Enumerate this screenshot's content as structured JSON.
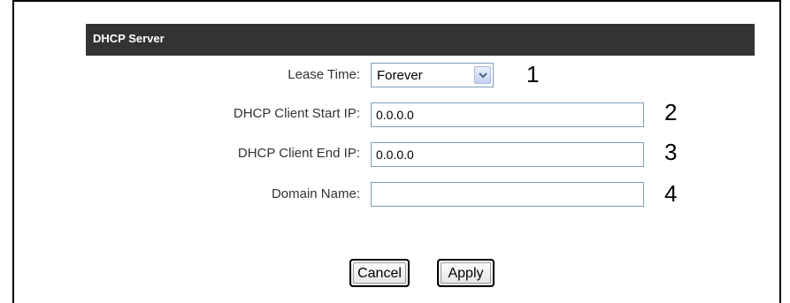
{
  "section": {
    "title": "DHCP Server"
  },
  "fields": {
    "lease_time": {
      "label": "Lease Time:",
      "value": "Forever",
      "marker": "1"
    },
    "start_ip": {
      "label": "DHCP Client Start IP:",
      "value": "0.0.0.0",
      "marker": "2"
    },
    "end_ip": {
      "label": "DHCP Client End IP:",
      "value": "0.0.0.0",
      "marker": "3"
    },
    "domain_name": {
      "label": "Domain Name:",
      "value": "",
      "marker": "4"
    }
  },
  "buttons": {
    "cancel": "Cancel",
    "apply": "Apply"
  },
  "icons": {
    "select_arrow": "chevron-down-icon"
  },
  "colors": {
    "header_bg": "#333333",
    "header_text": "#ffffff",
    "input_border": "#7f9db9"
  }
}
